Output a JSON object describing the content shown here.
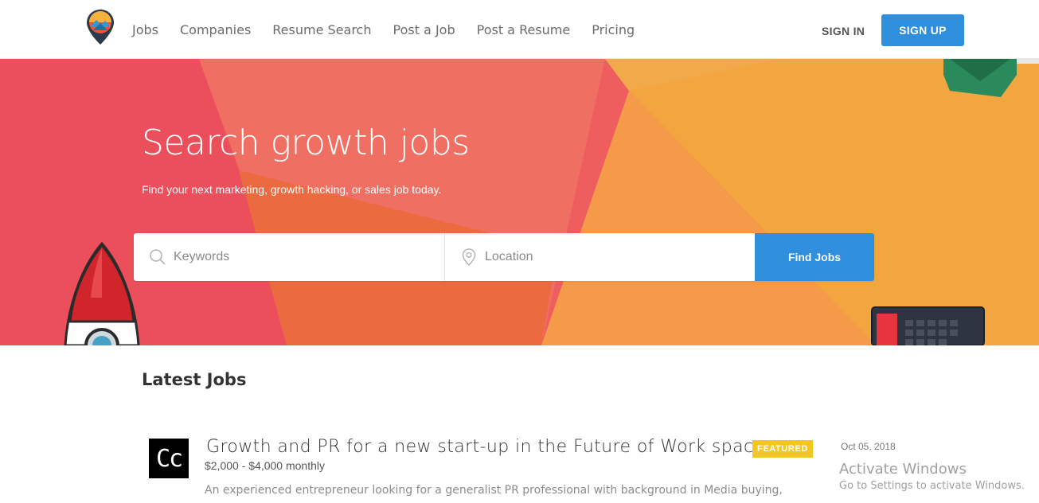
{
  "header": {
    "nav": [
      "Jobs",
      "Companies",
      "Resume Search",
      "Post a Job",
      "Post a Resume",
      "Pricing"
    ],
    "sign_in": "SIGN IN",
    "sign_up": "SIGN UP"
  },
  "hero": {
    "title": "Search growth jobs",
    "subtitle": "Find your next marketing, growth hacking, or sales job today.",
    "keywords_placeholder": "Keywords",
    "location_placeholder": "Location",
    "find_button": "Find Jobs"
  },
  "latest": {
    "heading": "Latest Jobs",
    "jobs": [
      {
        "logo_text": "Cc",
        "title": "Growth and PR for a new start-up in the Future of Work space",
        "badge": "FEATURED",
        "salary": "$2,000 - $4,000 monthly",
        "description": "An experienced entrepreneur looking for a generalist PR professional with background in Media buying,",
        "date": "Oct 05, 2018"
      }
    ]
  },
  "watermark": {
    "line1": "Activate Windows",
    "line2": "Go to Settings to activate Windows."
  },
  "colors": {
    "accent": "#2f8fdd",
    "badge": "#f4c624",
    "hero_red": "#ec5560",
    "hero_coral": "#f06e62",
    "hero_orange": "#f3a63f"
  },
  "icons": [
    "map-pin-logo-icon",
    "search-icon",
    "location-pin-icon",
    "rocket-illustration",
    "envelope-illustration",
    "laptop-illustration"
  ]
}
